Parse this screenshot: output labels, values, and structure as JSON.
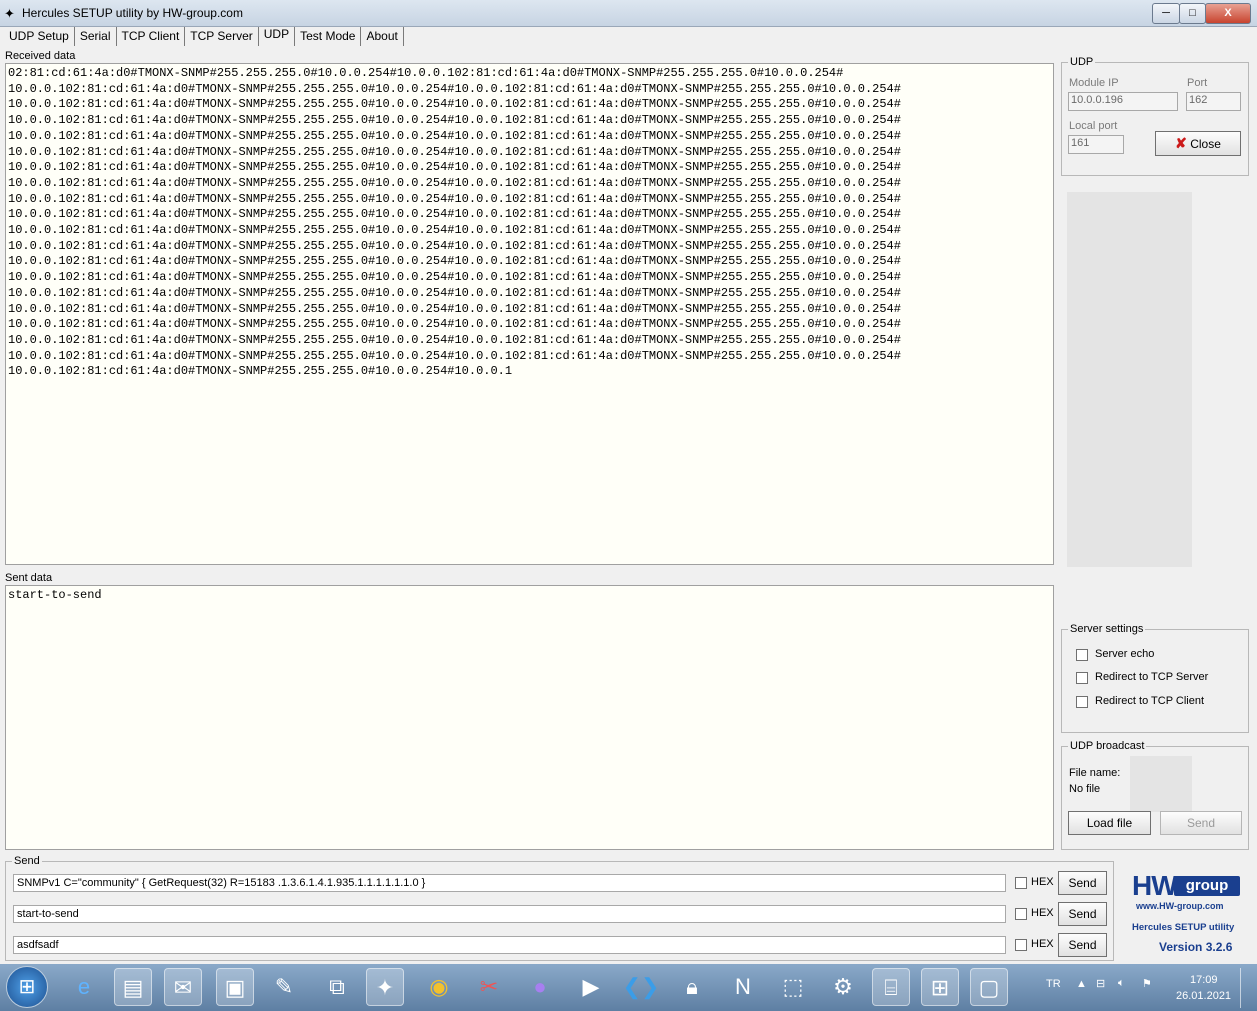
{
  "window": {
    "title": "Hercules SETUP utility by HW-group.com",
    "buttons": {
      "minimize": "─",
      "maximize": "□",
      "close": "X"
    }
  },
  "tabs": [
    "UDP Setup",
    "Serial",
    "TCP Client",
    "TCP Server",
    "UDP",
    "Test Mode",
    "About"
  ],
  "active_tab": "UDP",
  "received": {
    "label": "Received data",
    "lines": [
      "02:81:cd:61:4a:d0#TMONX-SNMP#255.255.255.0#10.0.0.254#10.0.0.102:81:cd:61:4a:d0#TMONX-SNMP#255.255.255.0#10.0.0.254#",
      "10.0.0.102:81:cd:61:4a:d0#TMONX-SNMP#255.255.255.0#10.0.0.254#10.0.0.102:81:cd:61:4a:d0#TMONX-SNMP#255.255.255.0#10.0.0.254#",
      "10.0.0.102:81:cd:61:4a:d0#TMONX-SNMP#255.255.255.0#10.0.0.254#10.0.0.102:81:cd:61:4a:d0#TMONX-SNMP#255.255.255.0#10.0.0.254#",
      "10.0.0.102:81:cd:61:4a:d0#TMONX-SNMP#255.255.255.0#10.0.0.254#10.0.0.102:81:cd:61:4a:d0#TMONX-SNMP#255.255.255.0#10.0.0.254#",
      "10.0.0.102:81:cd:61:4a:d0#TMONX-SNMP#255.255.255.0#10.0.0.254#10.0.0.102:81:cd:61:4a:d0#TMONX-SNMP#255.255.255.0#10.0.0.254#",
      "10.0.0.102:81:cd:61:4a:d0#TMONX-SNMP#255.255.255.0#10.0.0.254#10.0.0.102:81:cd:61:4a:d0#TMONX-SNMP#255.255.255.0#10.0.0.254#",
      "10.0.0.102:81:cd:61:4a:d0#TMONX-SNMP#255.255.255.0#10.0.0.254#10.0.0.102:81:cd:61:4a:d0#TMONX-SNMP#255.255.255.0#10.0.0.254#",
      "10.0.0.102:81:cd:61:4a:d0#TMONX-SNMP#255.255.255.0#10.0.0.254#10.0.0.102:81:cd:61:4a:d0#TMONX-SNMP#255.255.255.0#10.0.0.254#",
      "10.0.0.102:81:cd:61:4a:d0#TMONX-SNMP#255.255.255.0#10.0.0.254#10.0.0.102:81:cd:61:4a:d0#TMONX-SNMP#255.255.255.0#10.0.0.254#",
      "10.0.0.102:81:cd:61:4a:d0#TMONX-SNMP#255.255.255.0#10.0.0.254#10.0.0.102:81:cd:61:4a:d0#TMONX-SNMP#255.255.255.0#10.0.0.254#",
      "10.0.0.102:81:cd:61:4a:d0#TMONX-SNMP#255.255.255.0#10.0.0.254#10.0.0.102:81:cd:61:4a:d0#TMONX-SNMP#255.255.255.0#10.0.0.254#",
      "10.0.0.102:81:cd:61:4a:d0#TMONX-SNMP#255.255.255.0#10.0.0.254#10.0.0.102:81:cd:61:4a:d0#TMONX-SNMP#255.255.255.0#10.0.0.254#",
      "10.0.0.102:81:cd:61:4a:d0#TMONX-SNMP#255.255.255.0#10.0.0.254#10.0.0.102:81:cd:61:4a:d0#TMONX-SNMP#255.255.255.0#10.0.0.254#",
      "10.0.0.102:81:cd:61:4a:d0#TMONX-SNMP#255.255.255.0#10.0.0.254#10.0.0.102:81:cd:61:4a:d0#TMONX-SNMP#255.255.255.0#10.0.0.254#",
      "10.0.0.102:81:cd:61:4a:d0#TMONX-SNMP#255.255.255.0#10.0.0.254#10.0.0.102:81:cd:61:4a:d0#TMONX-SNMP#255.255.255.0#10.0.0.254#",
      "10.0.0.102:81:cd:61:4a:d0#TMONX-SNMP#255.255.255.0#10.0.0.254#10.0.0.102:81:cd:61:4a:d0#TMONX-SNMP#255.255.255.0#10.0.0.254#",
      "10.0.0.102:81:cd:61:4a:d0#TMONX-SNMP#255.255.255.0#10.0.0.254#10.0.0.102:81:cd:61:4a:d0#TMONX-SNMP#255.255.255.0#10.0.0.254#",
      "10.0.0.102:81:cd:61:4a:d0#TMONX-SNMP#255.255.255.0#10.0.0.254#10.0.0.102:81:cd:61:4a:d0#TMONX-SNMP#255.255.255.0#10.0.0.254#",
      "10.0.0.102:81:cd:61:4a:d0#TMONX-SNMP#255.255.255.0#10.0.0.254#10.0.0.102:81:cd:61:4a:d0#TMONX-SNMP#255.255.255.0#10.0.0.254#",
      "10.0.0.102:81:cd:61:4a:d0#TMONX-SNMP#255.255.255.0#10.0.0.254#10.0.0.1"
    ]
  },
  "sent": {
    "label": "Sent data",
    "text": "start-to-send"
  },
  "udp": {
    "legend": "UDP",
    "module_ip_label": "Module IP",
    "module_ip": "10.0.0.196",
    "port_label": "Port",
    "port": "162",
    "local_port_label": "Local port",
    "local_port": "161",
    "close_label": "Close"
  },
  "server_settings": {
    "legend": "Server settings",
    "options": [
      {
        "label": "Server echo",
        "checked": false
      },
      {
        "label": "Redirect to TCP Server",
        "checked": false
      },
      {
        "label": "Redirect to TCP Client",
        "checked": false
      }
    ]
  },
  "broadcast": {
    "legend": "UDP broadcast",
    "file_name_label": "File name:",
    "file_name": "No file",
    "load_label": "Load file",
    "send_label": "Send"
  },
  "send": {
    "legend": "Send",
    "rows": [
      {
        "text": "SNMPv1 C=\"community\" { GetRequest(32) R=15183  .1.3.6.1.4.1.935.1.1.1.1.1.1.0 }",
        "hex": "HEX",
        "button": "Send"
      },
      {
        "text": "start-to-send",
        "hex": "HEX",
        "button": "Send"
      },
      {
        "text": "asdfsadf",
        "hex": "HEX",
        "button": "Send"
      }
    ]
  },
  "logo": {
    "brand": "HW group",
    "url": "www.HW-group.com",
    "product": "Hercules SETUP utility",
    "version": "Version  3.2.6"
  },
  "taskbar": {
    "icons": [
      "start-orb-icon",
      "internet-explorer-icon",
      "file-explorer-icon",
      "thunderbird-icon",
      "image-viewer-icon",
      "notepad-icon",
      "network-tool-icon",
      "hercules-icon",
      "chrome-icon",
      "scissors-icon",
      "messenger-icon",
      "media-player-icon",
      "vscode-icon",
      "security-icon",
      "notion-icon",
      "screenshot-icon",
      "settings-icon",
      "terminal-icon",
      "diagram-icon",
      "window-icon"
    ],
    "tray": {
      "language": "TR",
      "time": "17:09",
      "date": "26.01.2021"
    }
  }
}
